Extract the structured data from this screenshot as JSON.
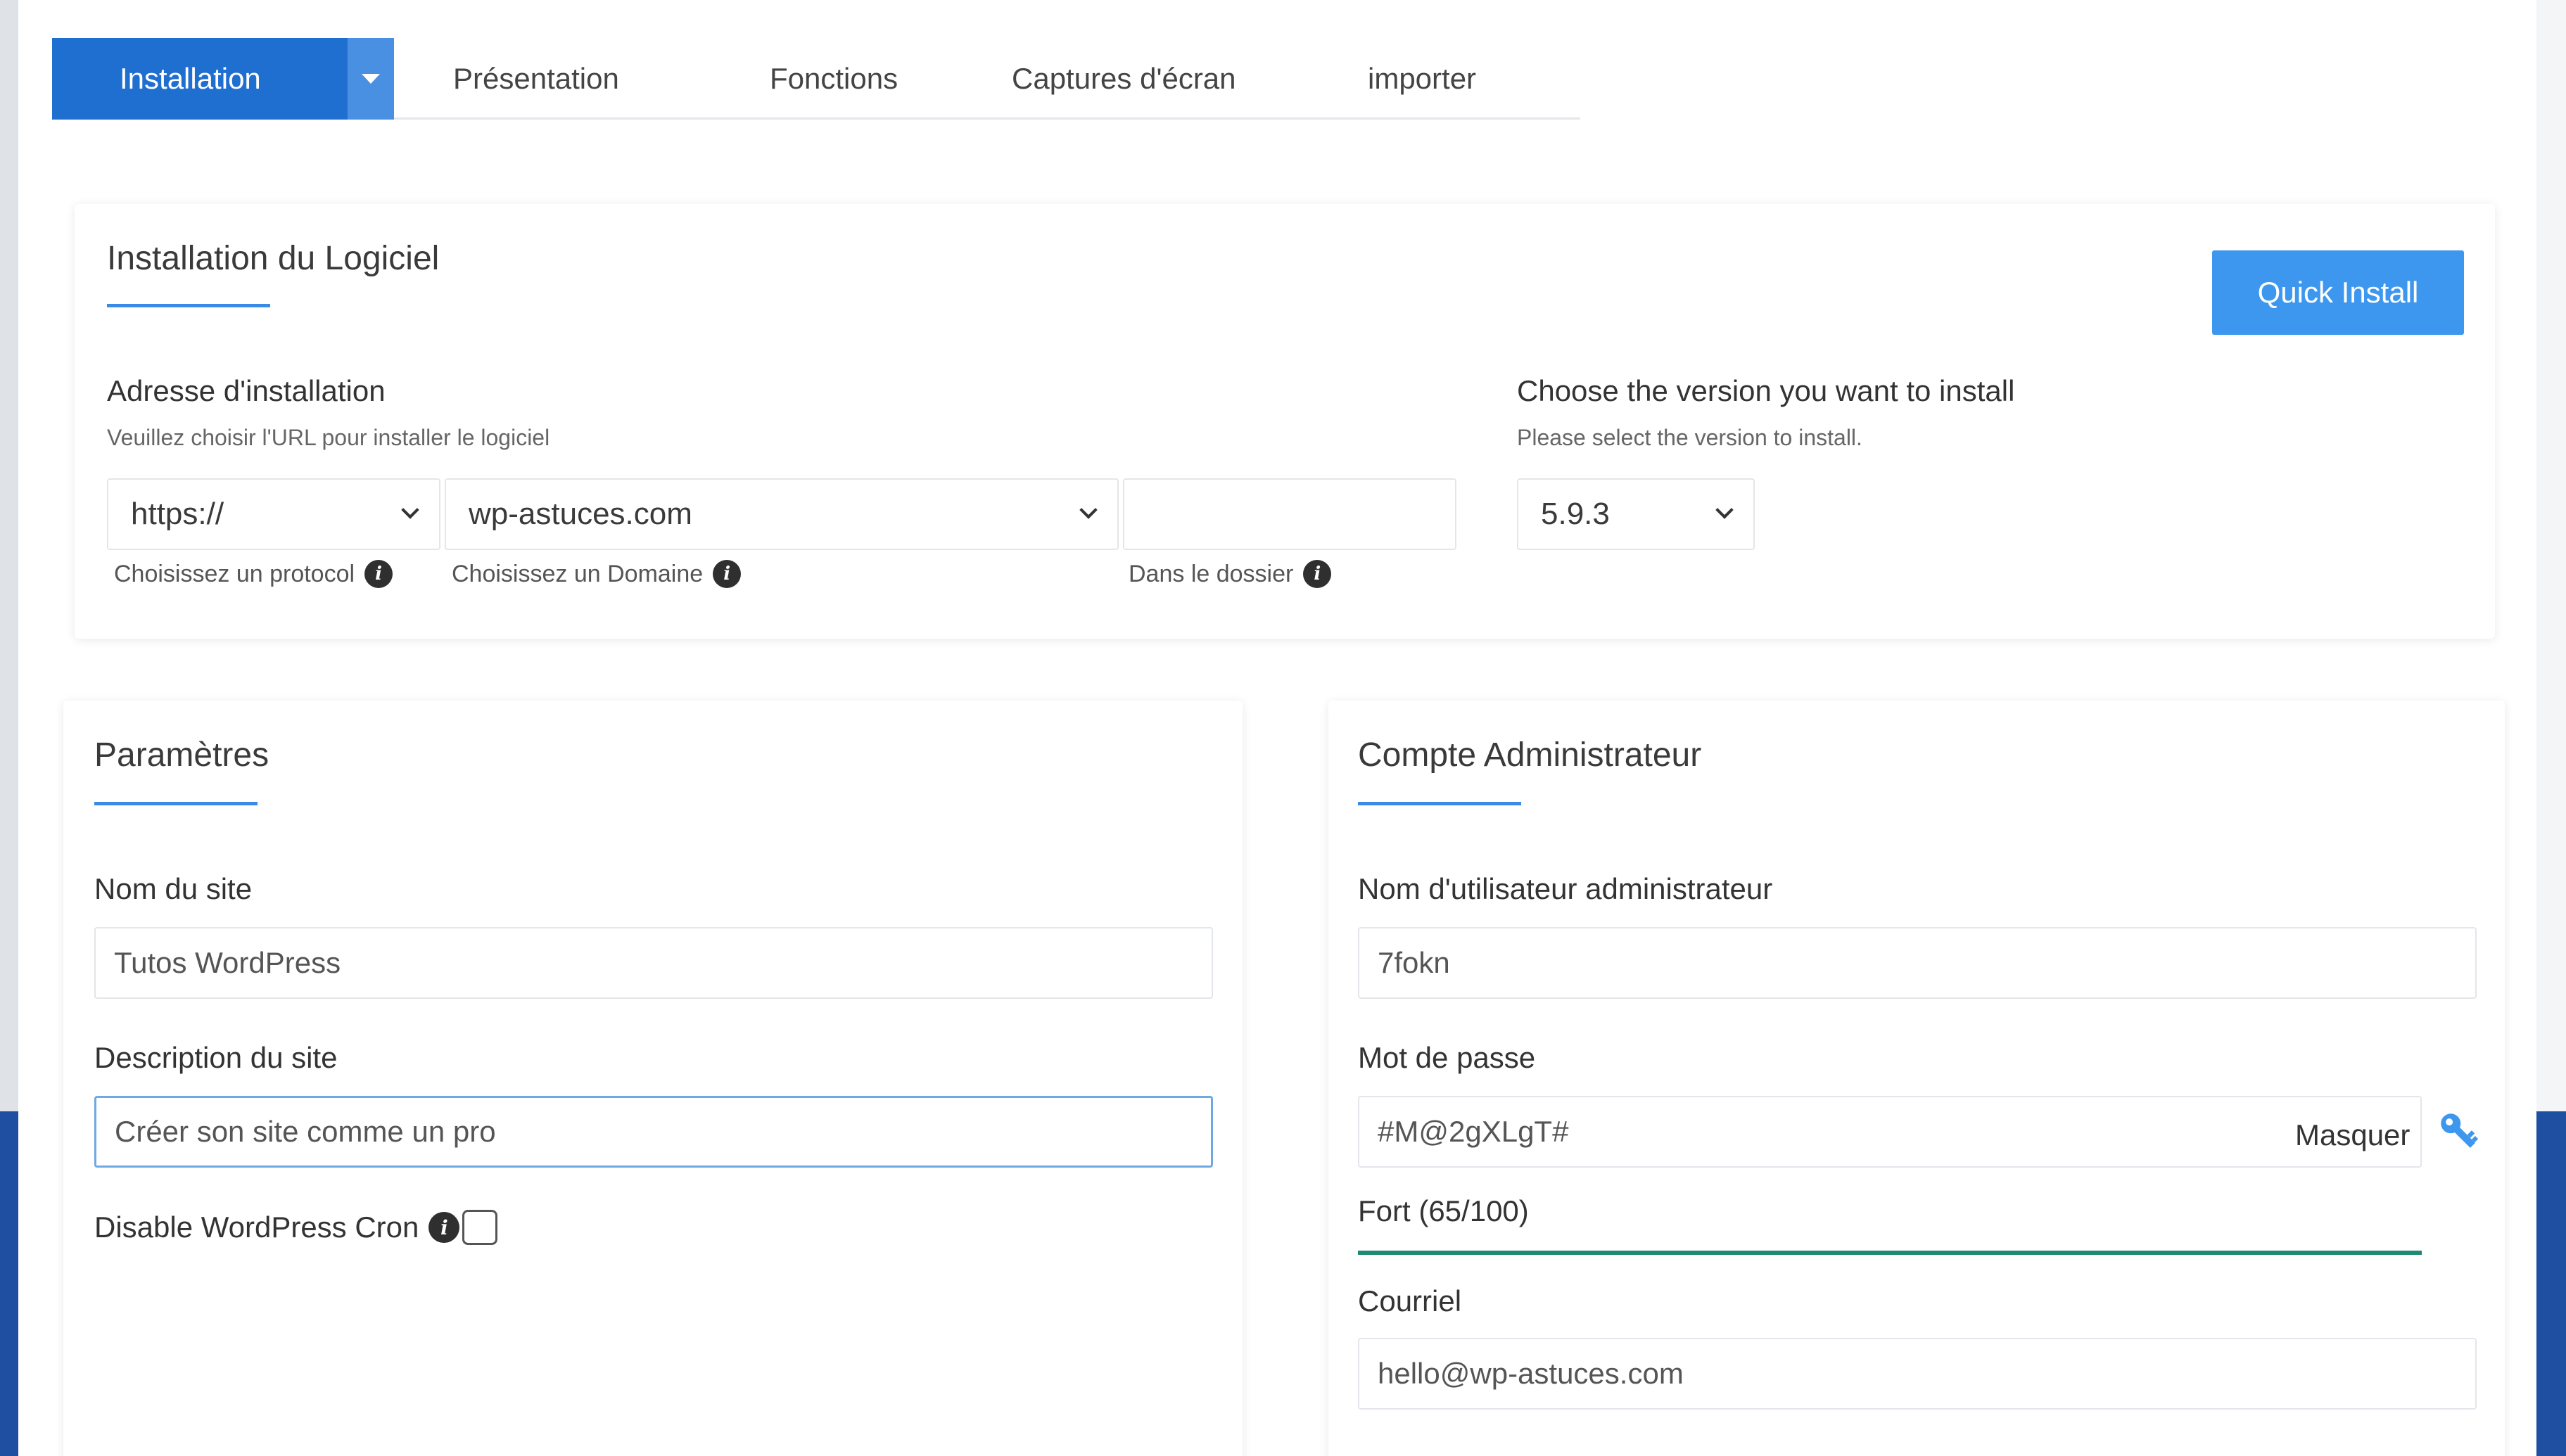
{
  "tabs": {
    "active": "Installation",
    "items": [
      "Présentation",
      "Fonctions",
      "Captures d'écran",
      "importer"
    ]
  },
  "software": {
    "title": "Installation du Logiciel",
    "quick_install": "Quick Install",
    "address_label": "Adresse d'installation",
    "address_help": "Veuillez choisir l'URL pour installer le logiciel",
    "protocol_value": "https://",
    "protocol_label": "Choisissez un protocol",
    "domain_value": "wp-astuces.com",
    "domain_label": "Choisissez un Domaine",
    "folder_value": "",
    "folder_label": "Dans le dossier",
    "version_label": "Choose the version you want to install",
    "version_help": "Please select the version to install.",
    "version_value": "5.9.3"
  },
  "params": {
    "title": "Paramètres",
    "site_name_label": "Nom du site",
    "site_name_value": "Tutos WordPress",
    "site_desc_label": "Description du site",
    "site_desc_value": "Créer son site comme un pro",
    "cron_label": "Disable WordPress Cron"
  },
  "admin": {
    "title": "Compte Administrateur",
    "username_label": "Nom d'utilisateur administrateur",
    "username_value": "7fokn",
    "password_label": "Mot de passe",
    "password_value": "#M@2gXLgT#",
    "hide_label": "Masquer",
    "strength_label": "Fort (65/100)",
    "strength_score": 65,
    "email_label": "Courriel",
    "email_value": "hello@wp-astuces.com"
  },
  "colors": {
    "primary": "#1f6fd1",
    "quick_install": "#3d97ee",
    "strength": "#1f8a74"
  },
  "icons": [
    "info-icon",
    "chevron-down-icon",
    "key-icon",
    "caret-down-icon"
  ]
}
